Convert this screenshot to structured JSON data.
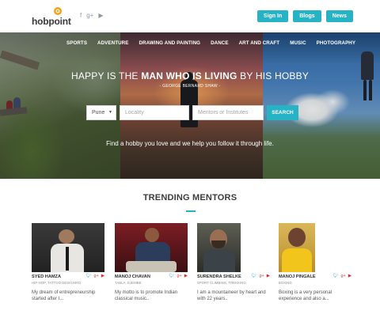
{
  "brand": {
    "name": "hobpoint"
  },
  "social": {
    "facebook": "f",
    "googleplus": "g+",
    "youtube": "▶"
  },
  "topnav": {
    "sign_in": "Sign In",
    "blogs": "Blogs",
    "news": "News"
  },
  "categories": [
    "SPORTS",
    "ADVENTURE",
    "DRAWING AND PAINTING",
    "DANCE",
    "ART AND CRAFT",
    "MUSIC",
    "PHOTOGRAPHY"
  ],
  "hero": {
    "headline_pre": "HAPPY IS THE ",
    "headline_bold": "MAN WHO IS LIVING",
    "headline_post": " BY HIS HOBBY",
    "quote_author": "- GEORGE BERNARD SHAW -",
    "tagline": "Find a hobby you love and we help you follow it through life."
  },
  "search": {
    "city": "Pune",
    "locality_placeholder": "Locality",
    "mentor_placeholder": "Mentors or Institutes",
    "button": "SEARCH"
  },
  "trending": {
    "title": "TRENDING MENTORS",
    "mentors": [
      {
        "name": "SYED HAMZA",
        "skills": "HIP-HOP, TATTOO DESIGNING",
        "bio": "My dream of entrepreneurship started after I..."
      },
      {
        "name": "MANOJ CHAVAN",
        "skills": "TABLA, DJEMBE",
        "bio": "My motto is to promote Indian classical music.."
      },
      {
        "name": "SURENDRA SHELKE",
        "skills": "SPORT CLIMBING, TREKKING",
        "bio": "I am a mountaineer by heart and with 22 years.."
      },
      {
        "name": "MANOJ PINGALE",
        "skills": "BOXING",
        "bio": "Boxing is a very personal experience and also a..."
      }
    ]
  },
  "colors": {
    "accent": "#27b3c6",
    "twitter": "#2fa6dd",
    "googleplus": "#c9483a",
    "youtube": "#d32a2a"
  }
}
